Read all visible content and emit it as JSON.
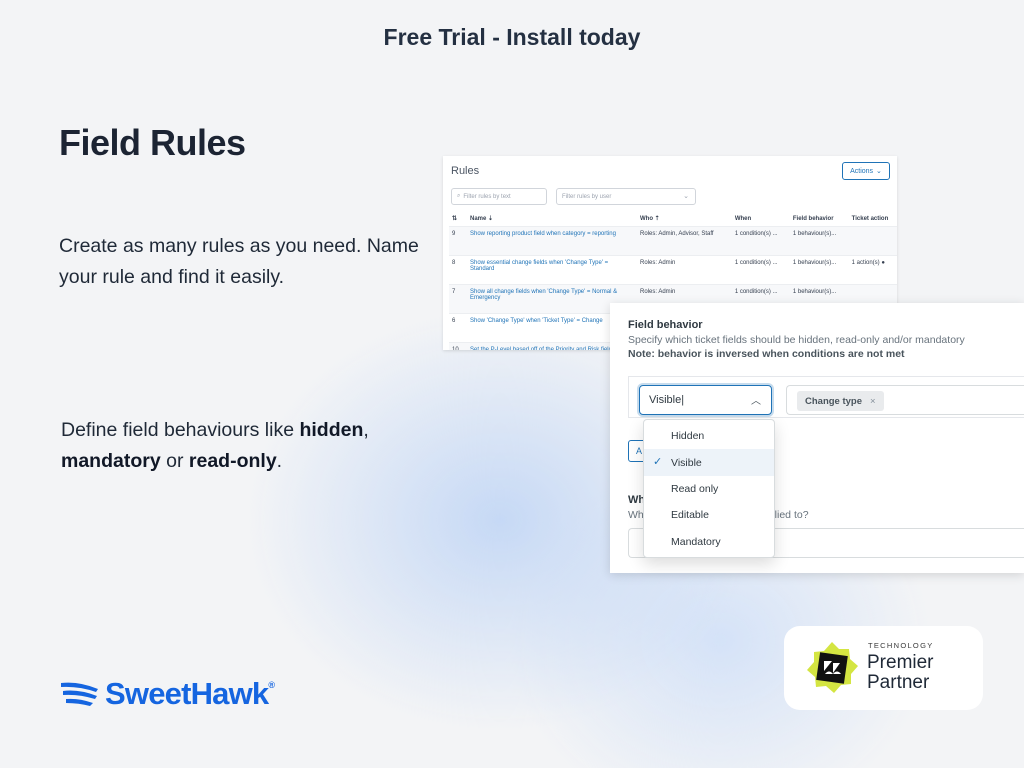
{
  "banner": "Free Trial - Install today",
  "page_title": "Field Rules",
  "para1": "Create as many rules as you need. Name your rule and find it easily.",
  "para2": {
    "prefix": "Define field behaviours like ",
    "hidden": "hidden",
    "comma": ",",
    "mandatory": "mandatory",
    "or": " or ",
    "readonly": "read-only",
    "period": "."
  },
  "rules_card": {
    "title": "Rules",
    "actions_label": "Actions",
    "filter_text_placeholder": "Filter rules by text",
    "filter_user_placeholder": "Filter rules by user",
    "columns": [
      "Name",
      "Who",
      "When",
      "Field behavior",
      "Ticket action",
      "A"
    ],
    "rows": [
      {
        "num": "9",
        "name": "Show reporting product field when category = reporting",
        "who": "Roles: Admin, Advisor, Staff",
        "when": "1 condition(s) ...",
        "behavior": "1 behaviour(s)...",
        "action": "",
        "a": "⌄"
      },
      {
        "num": "8",
        "name": "Show essential change fields when 'Change Type' = Standard",
        "who": "Roles: Admin",
        "when": "1 condition(s) ...",
        "behavior": "1 behaviour(s)...",
        "action": "1 action(s) ●",
        "a": "⌄"
      },
      {
        "num": "7",
        "name": "Show all change fields when 'Change Type' = Normal & Emergency",
        "who": "Roles: Admin",
        "when": "1 condition(s) ...",
        "behavior": "1 behaviour(s)...",
        "action": "",
        "a": "⌄"
      },
      {
        "num": "6",
        "name": "Show 'Change Type' when 'Ticket Type' = Change",
        "who": "",
        "when": "",
        "behavior": "",
        "action": "",
        "a": ""
      },
      {
        "num": "10",
        "name": "Set the P-Level based off of the Priority and Risk fields",
        "who": "",
        "when": "",
        "behavior": "",
        "action": "",
        "a": ""
      }
    ]
  },
  "field_behavior": {
    "title": "Field behavior",
    "description": "Specify which ticket fields should be hidden, read-only and/or mandatory",
    "note": "Note: behavior is inversed when conditions are not met",
    "select_value": "Visible",
    "tag": "Change type",
    "tag_remove": "×",
    "add_label": "A",
    "sub_title": "Wh",
    "sub_desc": "Wh",
    "sub_tail": "pplied to?",
    "options": [
      "Hidden",
      "Visible",
      "Read only",
      "Editable",
      "Mandatory"
    ],
    "selected_option": "Visible"
  },
  "brand": {
    "name": "SweetHawk",
    "registered": "®",
    "color": "#1565e0"
  },
  "partner": {
    "tech": "TECHNOLOGY",
    "line1": "Premier",
    "line2": "Partner",
    "badge_icon": "zendesk-logo-icon"
  }
}
